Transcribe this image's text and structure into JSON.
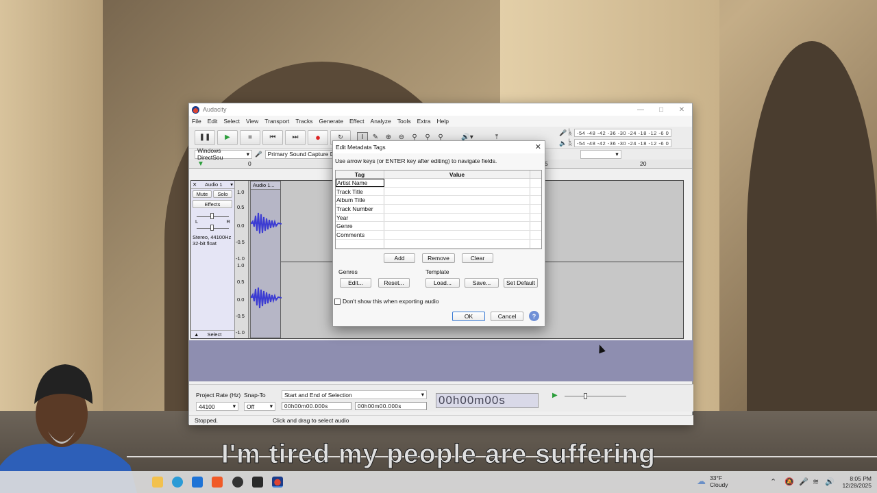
{
  "window": {
    "title": "Audacity"
  },
  "menu": [
    "File",
    "Edit",
    "Select",
    "View",
    "Transport",
    "Tracks",
    "Generate",
    "Effect",
    "Analyze",
    "Tools",
    "Extra",
    "Help"
  ],
  "meter": {
    "rec_scale": "-54 -48 -42 -36 -30 -24 -18 -12 -6 0",
    "play_scale": "-54 -48 -42 -36 -30 -24 -18 -12 -6 0",
    "l": "L",
    "r": "R"
  },
  "device": {
    "host": "Windows DirectSou",
    "rec_device": "Primary Sound Capture Dri"
  },
  "ruler": {
    "mark_0": "0",
    "mark_15": "5",
    "mark_20": "20"
  },
  "track": {
    "name": "Audio 1",
    "mute": "Mute",
    "solo": "Solo",
    "effects": "Effects",
    "pan_l": "L",
    "pan_r": "R",
    "info": "Stereo, 44100Hz 32-bit float",
    "select": "Select",
    "clip_name": "Audio 1...",
    "scale_top": [
      "1.0",
      "0.5",
      "0.0",
      "-0.5",
      "-1.0"
    ],
    "scale_bottom": [
      "1.0",
      "0.5",
      "0.0",
      "-0.5",
      "-1.0"
    ]
  },
  "dialog": {
    "title": "Edit Metadata Tags",
    "hint": "Use arrow keys (or ENTER key after editing) to navigate fields.",
    "col_tag": "Tag",
    "col_value": "Value",
    "rows": [
      "Artist Name",
      "Track Title",
      "Album Title",
      "Track Number",
      "Year",
      "Genre",
      "Comments"
    ],
    "add": "Add",
    "remove": "Remove",
    "clear": "Clear",
    "genres_label": "Genres",
    "template_label": "Template",
    "edit": "Edit...",
    "reset": "Reset...",
    "load": "Load...",
    "save": "Save...",
    "set_default": "Set Default",
    "dont_show": "Don't show this when exporting audio",
    "ok": "OK",
    "cancel": "Cancel",
    "help": "?"
  },
  "selection_bar": {
    "project_rate_label": "Project Rate (Hz)",
    "project_rate": "44100",
    "snap_label": "Snap-To",
    "snap_value": "Off",
    "range_mode": "Start and End of Selection",
    "start_time": "00h00m00.000s",
    "end_time": "00h00m00.000s",
    "big_time": "00h00m00s"
  },
  "status": {
    "state": "Stopped.",
    "hint": "Click and drag to select audio"
  },
  "caption": "I'm tired my people are suffering",
  "taskbar": {
    "temp": "33°F",
    "condition": "Cloudy",
    "time": "8:05 PM",
    "date": "12/28/2025"
  }
}
